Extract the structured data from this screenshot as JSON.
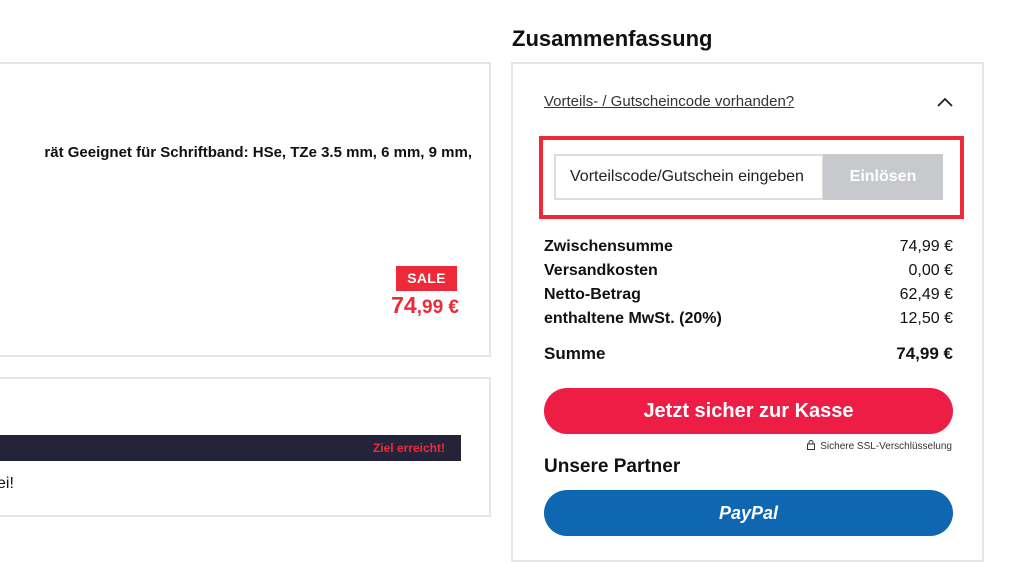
{
  "product": {
    "description": "rät Geeignet für Schriftband: HSe, TZe 3.5 mm, 6 mm, 9 mm,",
    "sale_badge": "SALE",
    "price_main": "74",
    "price_decimal": ",99 €"
  },
  "goal": {
    "bar_text": "Ziel erreicht!",
    "text": "ei!"
  },
  "summary": {
    "title": "Zusammenfassung",
    "voucher_link": "Vorteils- / Gutscheincode vorhanden?",
    "voucher_placeholder": "Vorteilscode/Gutschein eingeben",
    "voucher_button": "Einlösen",
    "rows": [
      {
        "label": "Zwischensumme",
        "value": "74,99 €"
      },
      {
        "label": "Versandkosten",
        "value": "0,00 €"
      },
      {
        "label": "Netto-Betrag",
        "value": "62,49 €"
      },
      {
        "label": "enthaltene MwSt. (20%)",
        "value": "12,50 €"
      }
    ],
    "total": {
      "label": "Summe",
      "value": "74,99 €"
    },
    "checkout_button": "Jetzt sicher zur Kasse",
    "ssl_text": "Sichere SSL-Verschlüsselung",
    "partners_title": "Unsere Partner",
    "paypal_button": "PayPal"
  },
  "colors": {
    "accent_red": "#ee2a3a",
    "checkout_red": "#ee1d45",
    "paypal_blue": "#0f67b1",
    "dark_bar": "#24233a"
  }
}
